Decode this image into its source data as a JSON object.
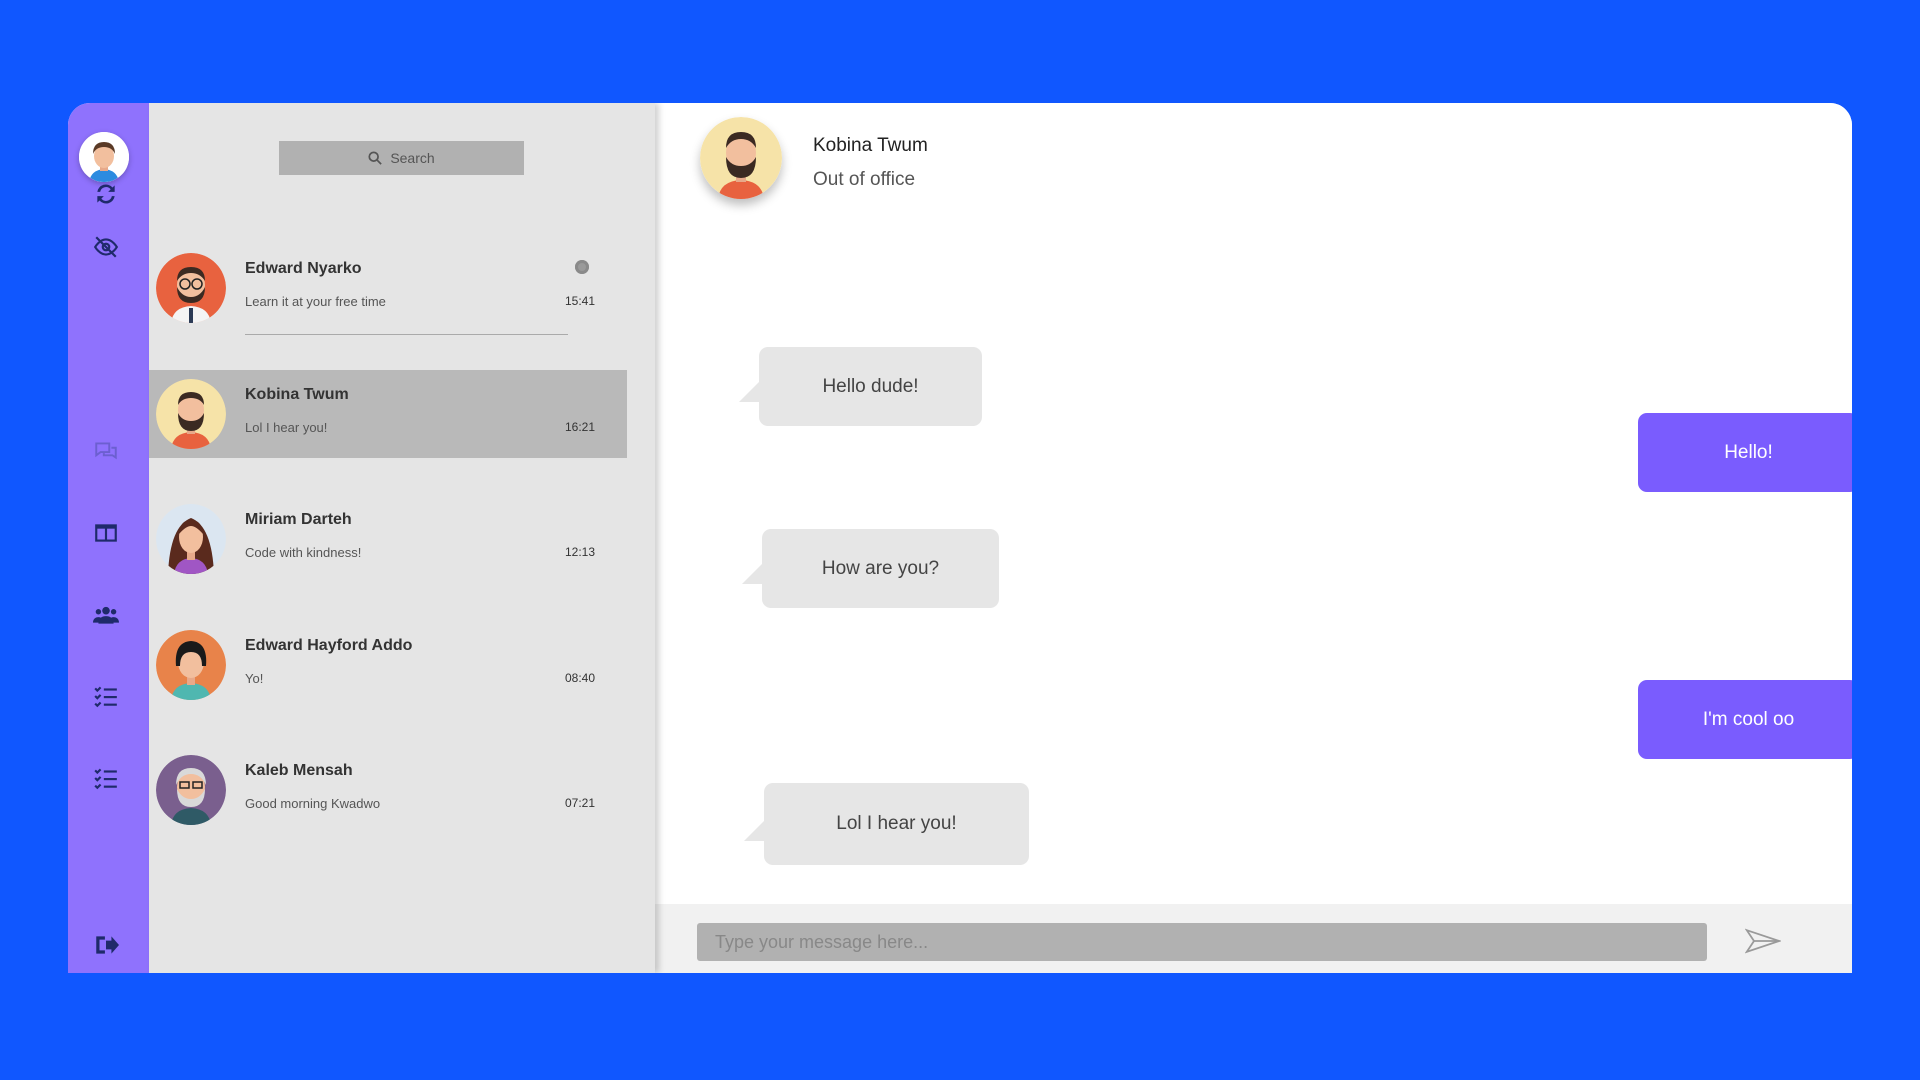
{
  "sidebar": {
    "icons": [
      "user-avatar",
      "refresh-icon",
      "eye-slash-icon",
      "chat-icon",
      "columns-icon",
      "users-icon",
      "checklist-icon",
      "checklist-icon",
      "sign-out-icon"
    ]
  },
  "search": {
    "label": "Search"
  },
  "contacts": [
    {
      "name": "Edward Nyarko",
      "message": "Learn it at your free time",
      "time": "15:41",
      "active": false
    },
    {
      "name": "Kobina Twum",
      "message": "Lol I hear you!",
      "time": "16:21",
      "active": true
    },
    {
      "name": "Miriam Darteh",
      "message": "Code with kindness!",
      "time": "12:13",
      "active": false
    },
    {
      "name": "Edward Hayford Addo",
      "message": "Yo!",
      "time": "08:40",
      "active": false
    },
    {
      "name": "Kaleb Mensah",
      "message": "Good morning Kwadwo",
      "time": "07:21",
      "active": false
    }
  ],
  "chat": {
    "name": "Kobina Twum",
    "status": "Out of office",
    "messages": [
      {
        "text": "Hello dude!",
        "direction": "in"
      },
      {
        "text": "Hello!",
        "direction": "out"
      },
      {
        "text": "How are you?",
        "direction": "in"
      },
      {
        "text": "I'm cool oo",
        "direction": "out"
      },
      {
        "text": "Lol I hear you!",
        "direction": "in"
      }
    ]
  },
  "composer": {
    "placeholder": "Type your message here..."
  },
  "colors": {
    "background": "#1057ff",
    "rail": "#8f72fd",
    "outgoing_bubble": "#7a5cfe",
    "incoming_bubble": "#e6e6e6",
    "contacts_panel": "#e5e5e5",
    "active_contact": "#b9b9b9"
  }
}
